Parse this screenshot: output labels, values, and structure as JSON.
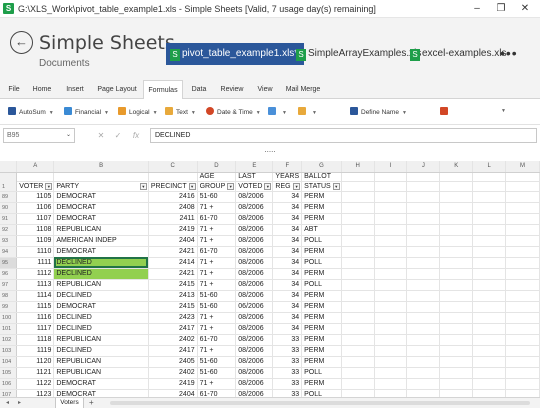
{
  "window": {
    "title": "G:\\XLS_Work\\pivot_table_example1.xls - Simple Sheets [Valid, 7 usage day(s) remaining]",
    "app_icon": "S",
    "minimize": "–",
    "restore": "❐",
    "close": "✕"
  },
  "header": {
    "app_name": "Simple Sheets",
    "subtitle": "Documents",
    "back_icon": "←",
    "more": "•••",
    "tabs": [
      {
        "label": "pivot_table_example1.xls*",
        "active": true
      },
      {
        "label": "SimpleArrayExamples.xls",
        "active": false
      },
      {
        "label": "excel-examples.xls",
        "active": false
      }
    ]
  },
  "ribbon": {
    "tabs": [
      "File",
      "Home",
      "Insert",
      "Page Layout",
      "Formulas",
      "Data",
      "Review",
      "View",
      "Mail Merge"
    ],
    "active_tab": "Formulas"
  },
  "toolbar": {
    "items": [
      {
        "label": "AutoSum",
        "icon": "sigma-icon",
        "color": "#2b579a"
      },
      {
        "label": "Financial",
        "icon": "financial-icon",
        "color": "#3a8ad4"
      },
      {
        "label": "Logical",
        "icon": "logical-icon",
        "color": "#e89a2c"
      },
      {
        "label": "Text",
        "icon": "text-icon",
        "color": "#e8a93b"
      },
      {
        "label": "Date & Time",
        "icon": "clock-icon",
        "color": "#d24726"
      },
      {
        "label": "",
        "icon": "lookup-icon",
        "color": "#4a90d9"
      },
      {
        "label": "",
        "icon": "math-icon",
        "color": "#e8a93b"
      },
      {
        "label": "Define Name",
        "icon": "define-name-icon",
        "color": "#2b579a"
      },
      {
        "label": "",
        "icon": "name-manager-icon",
        "color": "#d24726"
      },
      {
        "label": "",
        "icon": "more-functions-icon",
        "color": "#666666"
      }
    ]
  },
  "formula_bar": {
    "name_box": "B95",
    "cancel": "✕",
    "enter": "✓",
    "fx": "fx",
    "value": "DECLINED",
    "collapse": "....."
  },
  "grid": {
    "columns": [
      "A",
      "B",
      "C",
      "D",
      "E",
      "F",
      "G",
      "H",
      "I",
      "J",
      "K",
      "L",
      "M"
    ],
    "header_rows": [
      {
        "row": "",
        "a": "",
        "b": "",
        "c": "",
        "d": "AGE",
        "e": "LAST",
        "f": "YEARS",
        "g": "BALLOT"
      },
      {
        "row": "1",
        "a": "VOTER",
        "b": "PARTY",
        "c": "PRECINCT",
        "d": "GROUP",
        "e": "VOTED",
        "f": "REG",
        "g": "STATUS"
      }
    ],
    "rows": [
      {
        "row": "89",
        "voter": "1105",
        "party": "DEMOCRAT",
        "precinct": "2416",
        "age": "51-60",
        "voted": "08/2006",
        "years": "34",
        "status": "PERM"
      },
      {
        "row": "90",
        "voter": "1106",
        "party": "DEMOCRAT",
        "precinct": "2408",
        "age": "71 +",
        "voted": "08/2006",
        "years": "34",
        "status": "PERM"
      },
      {
        "row": "91",
        "voter": "1107",
        "party": "DEMOCRAT",
        "precinct": "2411",
        "age": "61-70",
        "voted": "08/2006",
        "years": "34",
        "status": "PERM"
      },
      {
        "row": "92",
        "voter": "1108",
        "party": "REPUBLICAN",
        "precinct": "2419",
        "age": "71 +",
        "voted": "08/2006",
        "years": "34",
        "status": "ABT"
      },
      {
        "row": "93",
        "voter": "1109",
        "party": "AMERICAN INDEP",
        "precinct": "2404",
        "age": "71 +",
        "voted": "08/2006",
        "years": "34",
        "status": "POLL"
      },
      {
        "row": "94",
        "voter": "1110",
        "party": "DEMOCRAT",
        "precinct": "2421",
        "age": "61-70",
        "voted": "08/2006",
        "years": "34",
        "status": "PERM"
      },
      {
        "row": "95",
        "voter": "1111",
        "party": "DECLINED",
        "precinct": "2414",
        "age": "71 +",
        "voted": "08/2006",
        "years": "34",
        "status": "POLL",
        "highlight": true,
        "selected": true
      },
      {
        "row": "96",
        "voter": "1112",
        "party": "DECLINED",
        "precinct": "2421",
        "age": "71 +",
        "voted": "08/2006",
        "years": "34",
        "status": "PERM",
        "highlight": true
      },
      {
        "row": "97",
        "voter": "1113",
        "party": "REPUBLICAN",
        "precinct": "2415",
        "age": "71 +",
        "voted": "08/2006",
        "years": "34",
        "status": "POLL"
      },
      {
        "row": "98",
        "voter": "1114",
        "party": "DECLINED",
        "precinct": "2413",
        "age": "51-60",
        "voted": "08/2006",
        "years": "34",
        "status": "PERM"
      },
      {
        "row": "99",
        "voter": "1115",
        "party": "DEMOCRAT",
        "precinct": "2415",
        "age": "51-60",
        "voted": "06/2006",
        "years": "34",
        "status": "PERM"
      },
      {
        "row": "100",
        "voter": "1116",
        "party": "DECLINED",
        "precinct": "2423",
        "age": "71 +",
        "voted": "08/2006",
        "years": "34",
        "status": "PERM"
      },
      {
        "row": "101",
        "voter": "1117",
        "party": "DECLINED",
        "precinct": "2417",
        "age": "71 +",
        "voted": "08/2006",
        "years": "34",
        "status": "PERM"
      },
      {
        "row": "102",
        "voter": "1118",
        "party": "REPUBLICAN",
        "precinct": "2402",
        "age": "61-70",
        "voted": "08/2006",
        "years": "33",
        "status": "PERM"
      },
      {
        "row": "103",
        "voter": "1119",
        "party": "DECLINED",
        "precinct": "2417",
        "age": "71 +",
        "voted": "08/2006",
        "years": "33",
        "status": "PERM"
      },
      {
        "row": "104",
        "voter": "1120",
        "party": "REPUBLICAN",
        "precinct": "2405",
        "age": "51-60",
        "voted": "08/2006",
        "years": "33",
        "status": "PERM"
      },
      {
        "row": "105",
        "voter": "1121",
        "party": "REPUBLICAN",
        "precinct": "2402",
        "age": "51-60",
        "voted": "08/2006",
        "years": "33",
        "status": "POLL"
      },
      {
        "row": "106",
        "voter": "1122",
        "party": "DEMOCRAT",
        "precinct": "2419",
        "age": "71 +",
        "voted": "08/2006",
        "years": "33",
        "status": "PERM"
      },
      {
        "row": "107",
        "voter": "1123",
        "party": "DEMOCRAT",
        "precinct": "2404",
        "age": "61-70",
        "voted": "08/2006",
        "years": "33",
        "status": "POLL"
      }
    ],
    "highlight_color": "#92d050"
  },
  "sheets": {
    "tabs": [
      "Voters"
    ],
    "add_icon": "+",
    "nav_first": "◂",
    "nav_last": "▸"
  }
}
